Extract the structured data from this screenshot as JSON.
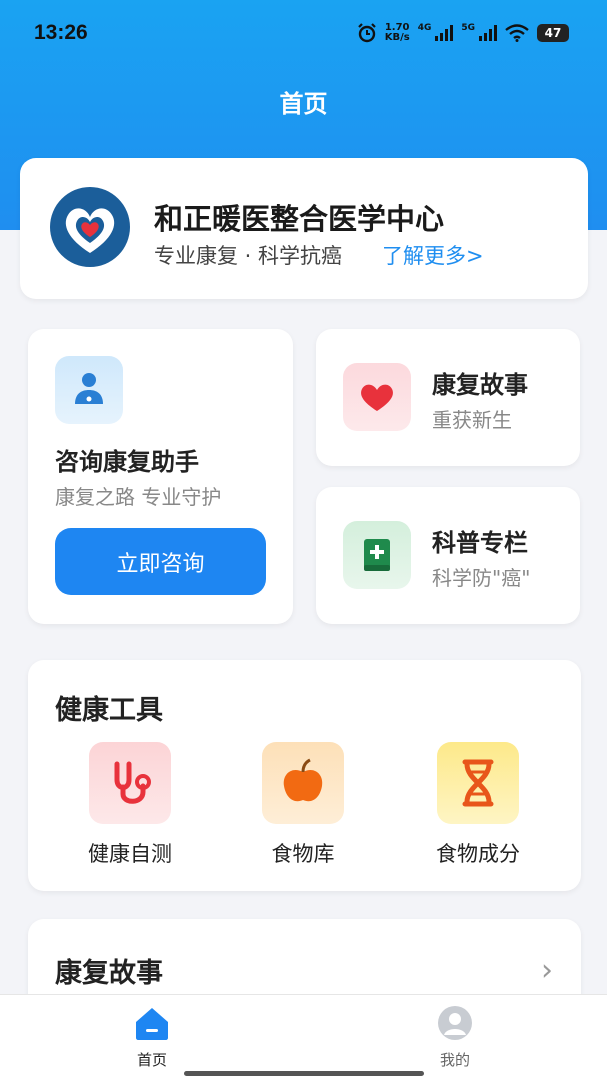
{
  "status_bar": {
    "time": "13:26",
    "net_speed_value": "1.70",
    "net_speed_unit": "KB/s",
    "signal1_label": "4G",
    "signal2_label": "5G",
    "battery": "47"
  },
  "header": {
    "title": "首页"
  },
  "org": {
    "name": "和正暖医整合医学中心",
    "tagline": "专业康复 · 科学抗癌",
    "more_link": "了解更多>"
  },
  "consult": {
    "title": "咨询康复助手",
    "subtitle": "康复之路 专业守护",
    "button": "立即咨询"
  },
  "story_card": {
    "title": "康复故事",
    "subtitle": "重获新生"
  },
  "science_card": {
    "title": "科普专栏",
    "subtitle": "科学防\"癌\""
  },
  "tools": {
    "title": "健康工具",
    "items": [
      {
        "label": "健康自测",
        "icon": "stethoscope-icon"
      },
      {
        "label": "食物库",
        "icon": "apple-icon"
      },
      {
        "label": "食物成分",
        "icon": "dna-icon"
      }
    ]
  },
  "stories_section": {
    "title": "康复故事"
  },
  "tab_bar": {
    "home": "首页",
    "mine": "我的"
  },
  "colors": {
    "primary": "#1e86f2",
    "header_gradient_top": "#1aa3f2",
    "logo_blue": "#1b5e9a",
    "heart_red": "#e8323c"
  }
}
